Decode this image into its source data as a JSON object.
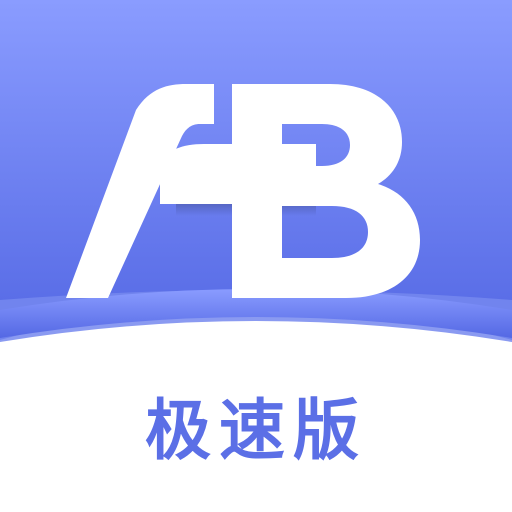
{
  "app_icon": {
    "logo_mark": "AB",
    "caption": "极速版",
    "colors": {
      "gradient_top": "#8a9cff",
      "gradient_bottom": "#5468e4",
      "band": "#7688ef",
      "letters": "#ffffff",
      "caption": "#5b6fe6",
      "background": "#ffffff"
    }
  }
}
